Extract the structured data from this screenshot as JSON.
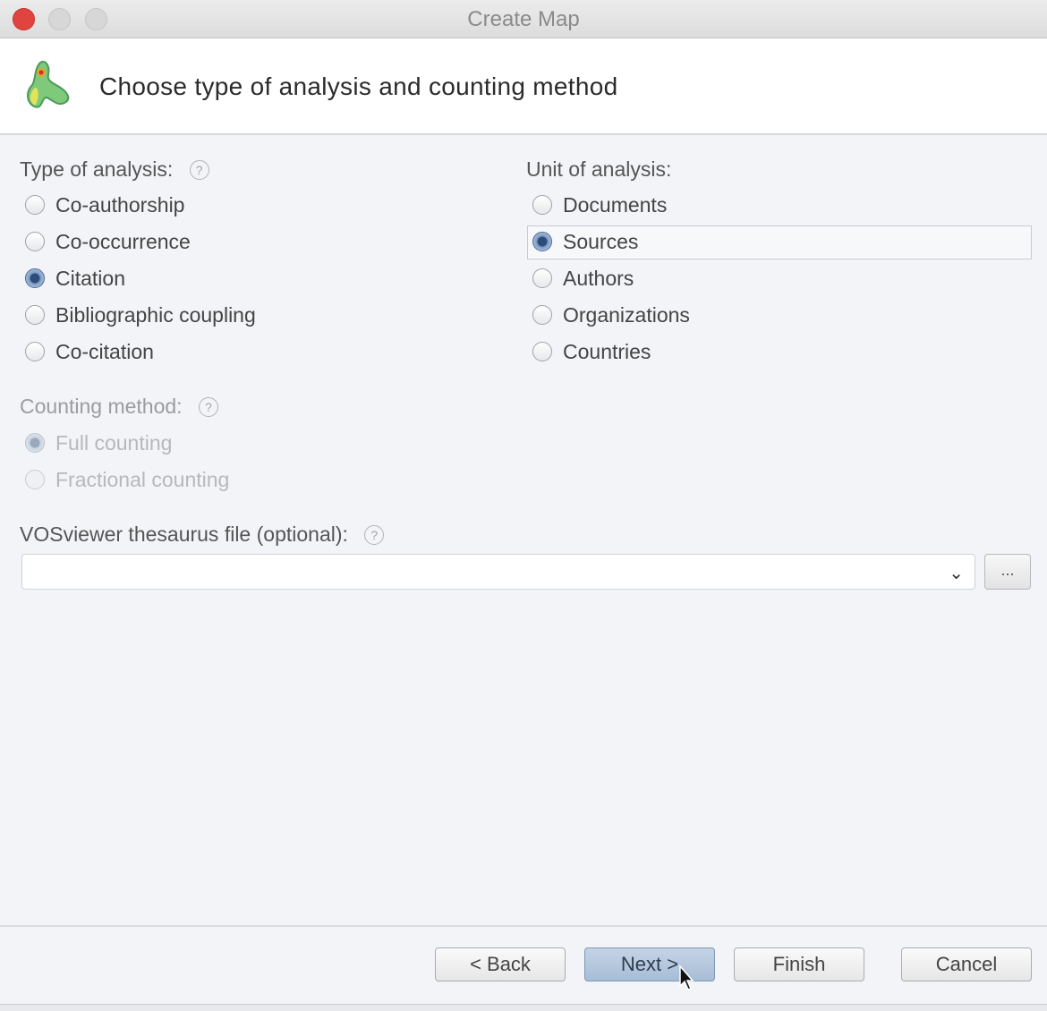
{
  "window": {
    "title": "Create Map"
  },
  "header": {
    "title": "Choose type of analysis and counting method",
    "icon": "vosviewer-logo-icon"
  },
  "analysis_type": {
    "label": "Type of analysis:",
    "options": [
      {
        "label": "Co-authorship",
        "checked": false
      },
      {
        "label": "Co-occurrence",
        "checked": false
      },
      {
        "label": "Citation",
        "checked": true
      },
      {
        "label": "Bibliographic coupling",
        "checked": false
      },
      {
        "label": "Co-citation",
        "checked": false
      }
    ]
  },
  "unit_of_analysis": {
    "label": "Unit of analysis:",
    "options": [
      {
        "label": "Documents",
        "checked": false
      },
      {
        "label": "Sources",
        "checked": true
      },
      {
        "label": "Authors",
        "checked": false
      },
      {
        "label": "Organizations",
        "checked": false
      },
      {
        "label": "Countries",
        "checked": false
      }
    ]
  },
  "counting_method": {
    "label": "Counting method:",
    "options": [
      {
        "label": "Full counting",
        "checked": true
      },
      {
        "label": "Fractional counting",
        "checked": false
      }
    ]
  },
  "thesaurus": {
    "label": "VOSviewer thesaurus file (optional):",
    "value": "",
    "browse_label": "..."
  },
  "buttons": {
    "back": "< Back",
    "next": "Next >",
    "finish": "Finish",
    "cancel": "Cancel"
  },
  "help_glyph": "?"
}
